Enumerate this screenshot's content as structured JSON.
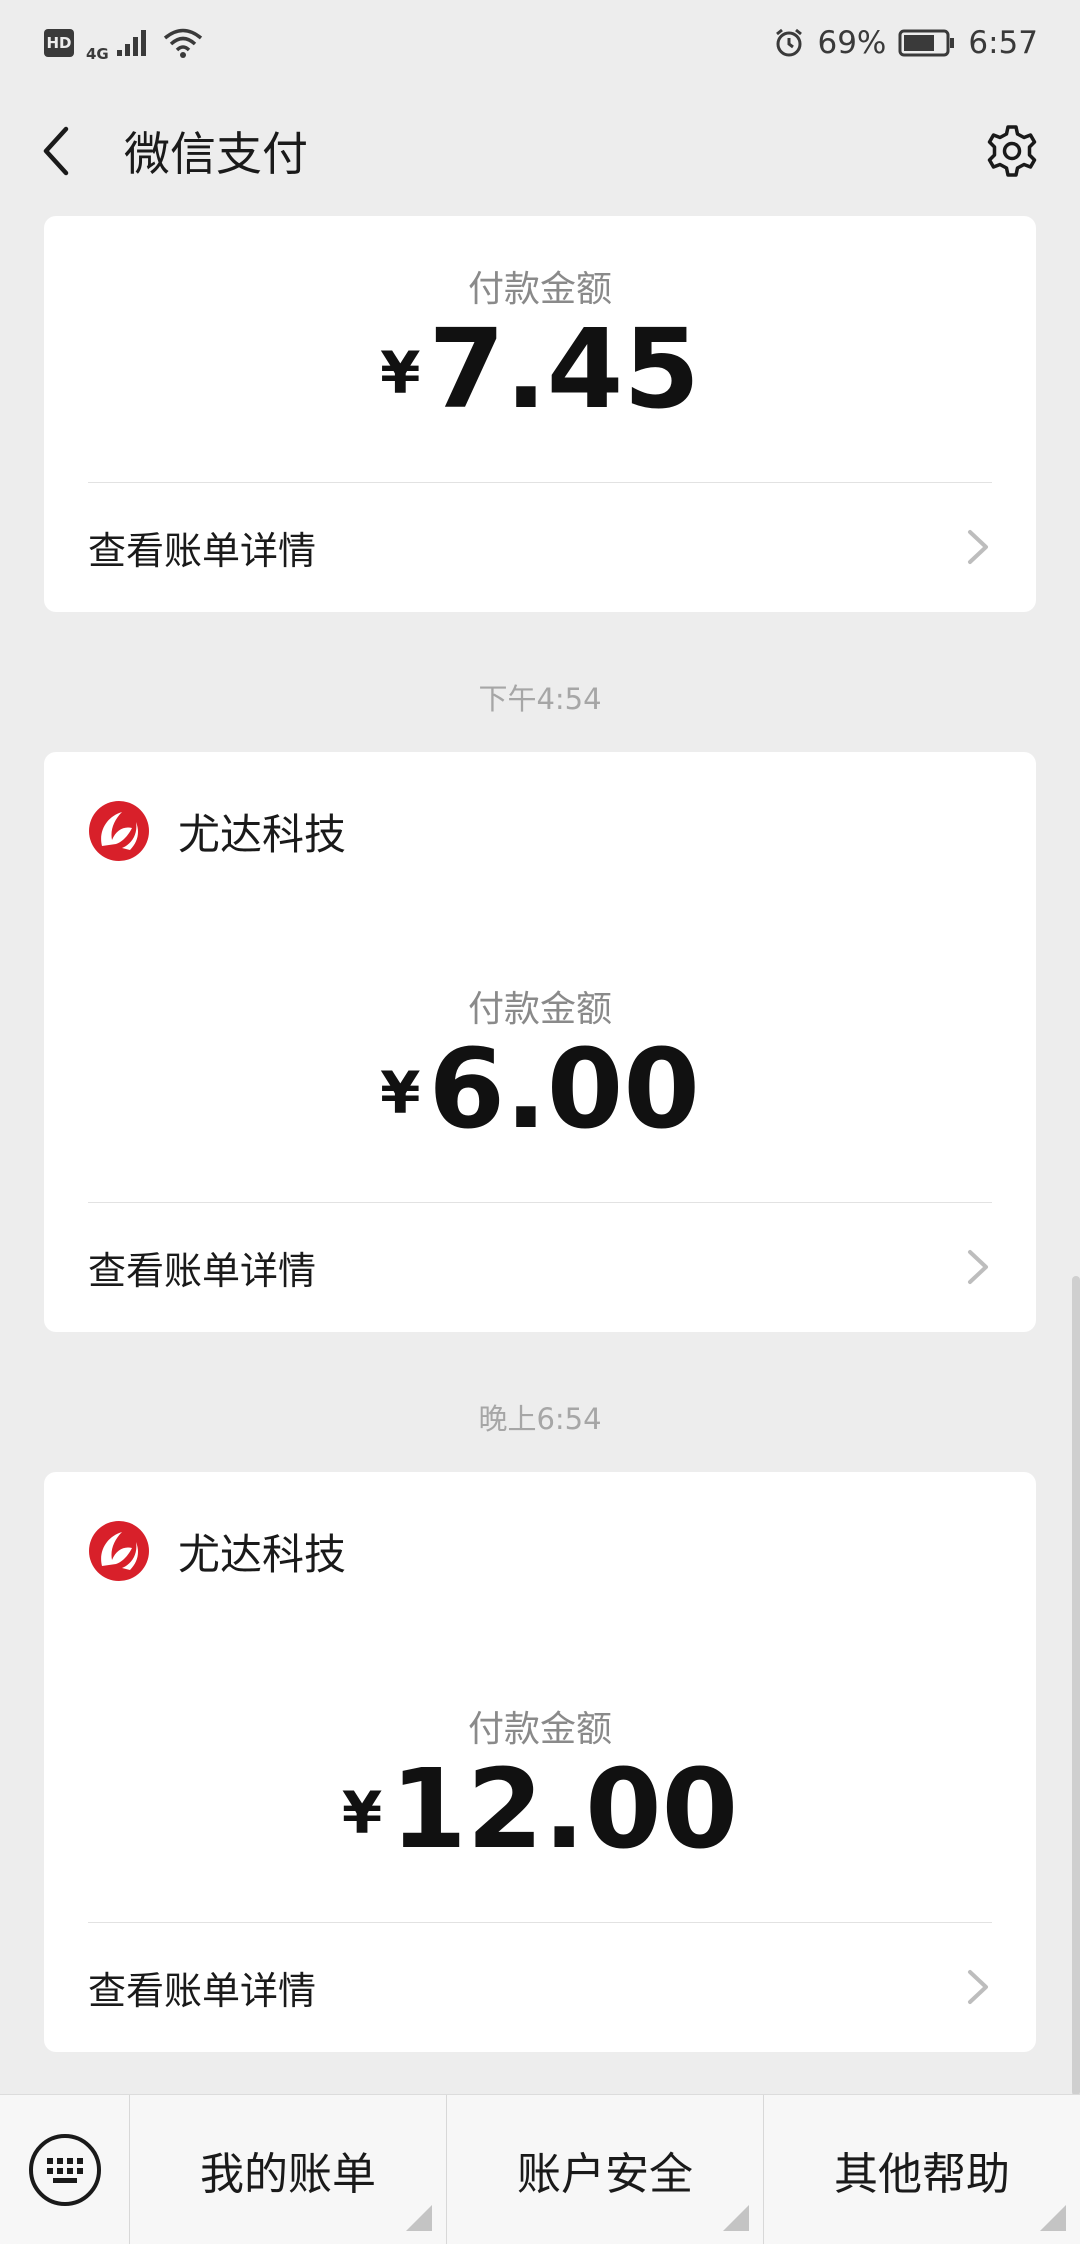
{
  "status_bar": {
    "hd": "HD",
    "network": "4G",
    "battery_percent": "69%",
    "time": "6:57"
  },
  "nav": {
    "title": "微信支付"
  },
  "payments": [
    {
      "merchant": "",
      "amount_label": "付款金额",
      "currency": "¥",
      "amount": "7.45",
      "detail_label": "查看账单详情"
    },
    {
      "time": "下午4:54",
      "merchant": "尤达科技",
      "amount_label": "付款金额",
      "currency": "¥",
      "amount": "6.00",
      "detail_label": "查看账单详情"
    },
    {
      "time": "晚上6:54",
      "merchant": "尤达科技",
      "amount_label": "付款金额",
      "currency": "¥",
      "amount": "12.00",
      "detail_label": "查看账单详情"
    }
  ],
  "bottom_menu": {
    "items": [
      "我的账单",
      "账户安全",
      "其他帮助"
    ]
  },
  "colors": {
    "background": "#ededed",
    "card": "#ffffff",
    "logo_red": "#d8202a"
  },
  "icons": {
    "back": "back-arrow-icon",
    "settings": "gear-icon",
    "keyboard": "keyboard-icon",
    "chevron": "chevron-right-icon",
    "merchant_logo": "merchant-logo-icon"
  }
}
